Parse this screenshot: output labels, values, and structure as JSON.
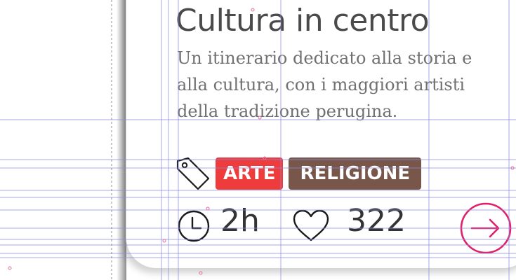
{
  "card": {
    "title": "Cultura in centro",
    "description": "Un itinerario dedicato alla storia e alla cultura, con i maggiori artisti della tradizione perugina.",
    "tags": [
      {
        "label": "ARTE",
        "color": "#ee3b3b"
      },
      {
        "label": "RELIGIONE",
        "color": "#79564a"
      }
    ],
    "duration": "2h",
    "likes": "322",
    "icons": {
      "tag": "tag-icon",
      "clock": "clock-icon",
      "heart": "heart-outline-icon",
      "go": "arrow-right-circle-icon"
    },
    "accent_color": "#e0206a"
  }
}
